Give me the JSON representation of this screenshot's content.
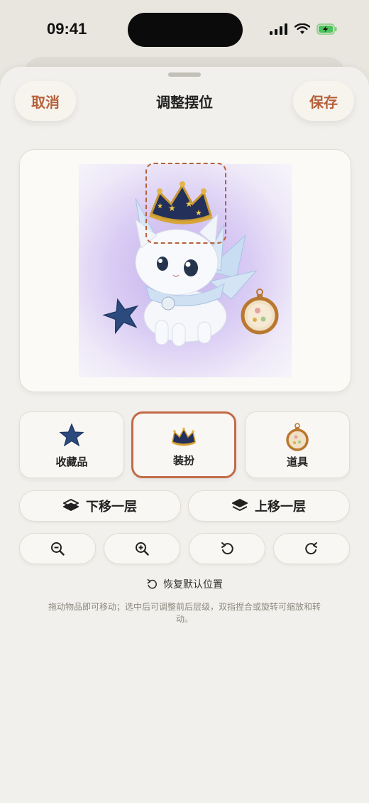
{
  "status_bar": {
    "time": "09:41"
  },
  "nav": {
    "title": "调整摆位",
    "cancel_label": "取消",
    "save_label": "保存"
  },
  "categories": [
    {
      "label": "收藏品",
      "icon": "star-icon",
      "selected": false
    },
    {
      "label": "装扮",
      "icon": "crown-icon",
      "selected": true
    },
    {
      "label": "道具",
      "icon": "pocket-watch-icon",
      "selected": false
    }
  ],
  "layer_controls": {
    "move_down_label": "下移一层",
    "move_up_label": "上移一层"
  },
  "tools": [
    {
      "name": "zoom-out",
      "icon": "zoom-out-icon"
    },
    {
      "name": "zoom-in",
      "icon": "zoom-in-icon"
    },
    {
      "name": "rotate-left",
      "icon": "rotate-left-icon"
    },
    {
      "name": "rotate-right",
      "icon": "rotate-right-icon"
    }
  ],
  "reset_label": "恢复默认位置",
  "hint_text": "拖动物品即可移动；选中后可调整前后层级，双指捏合或旋转可缩放和转动。",
  "colors": {
    "accent": "#c36a48",
    "background": "#e9e6e0",
    "card": "#f9f7f3"
  }
}
